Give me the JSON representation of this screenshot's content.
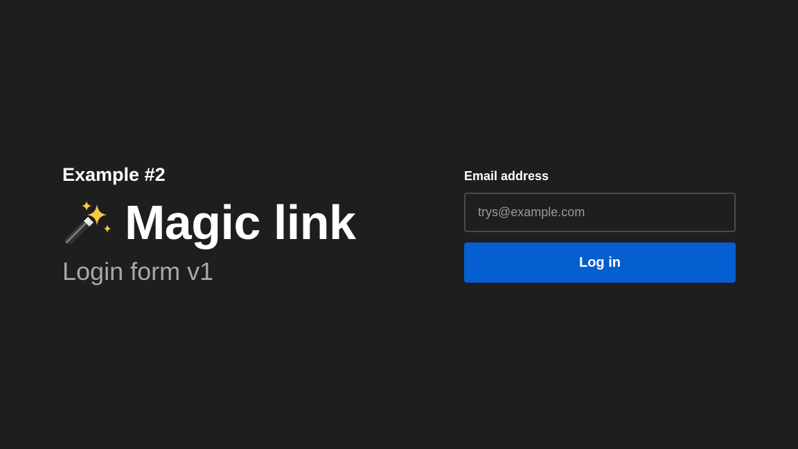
{
  "intro": {
    "eyebrow": "Example #2",
    "title": "Magic link",
    "subtitle": "Login form v1",
    "title_icon": "magic-wand-sparkles-icon"
  },
  "form": {
    "email_label": "Email address",
    "email_placeholder": "trys@example.com",
    "email_value": "",
    "submit_label": "Log in"
  },
  "colors": {
    "background": "#1e1e1e",
    "text": "#ffffff",
    "muted_text": "#a9a9a2",
    "input_border": "#4b4b4b",
    "button": "#055fd1"
  }
}
